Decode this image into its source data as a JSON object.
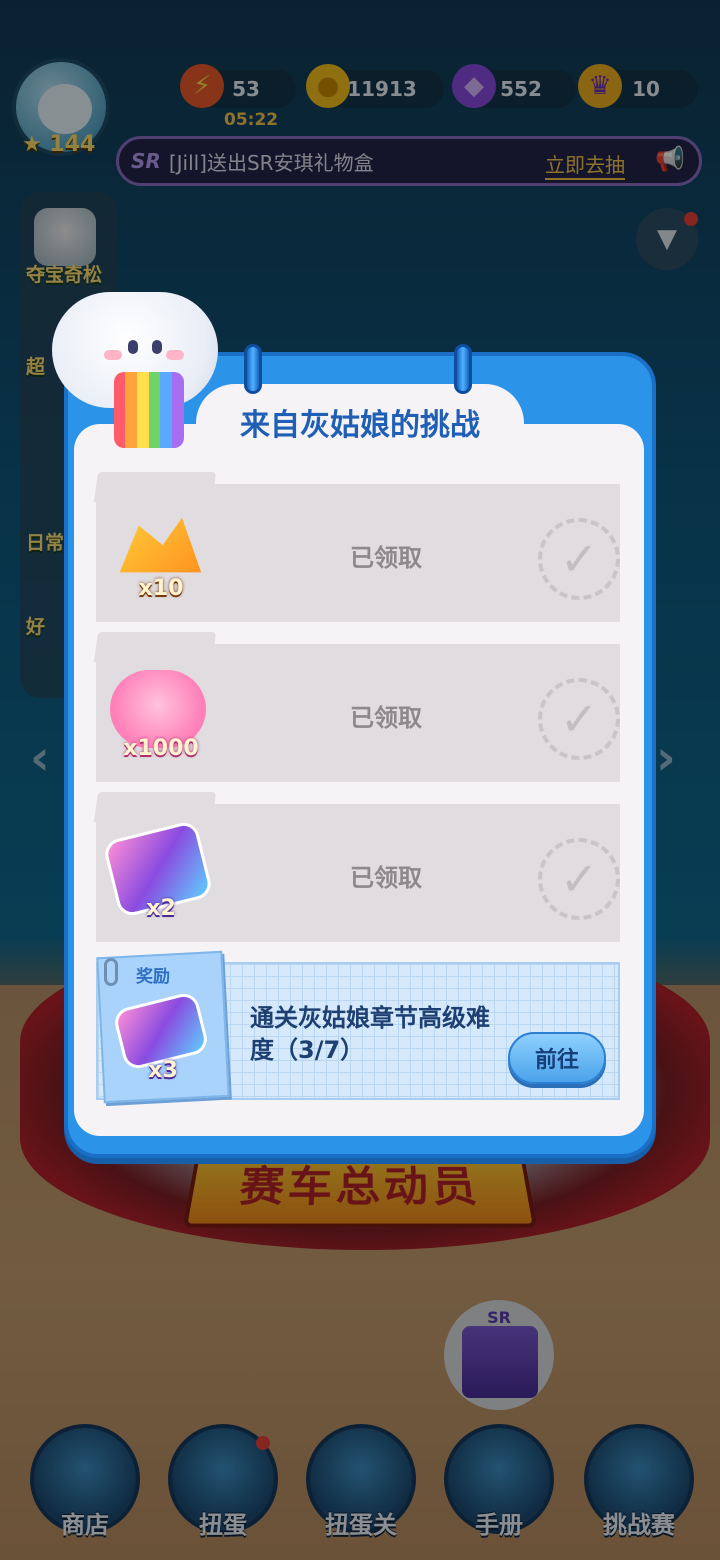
{
  "hud": {
    "level": "144",
    "energy": "53",
    "energy_timer": "05:22",
    "coins": "11913",
    "gems": "552",
    "crowns": "10"
  },
  "news": {
    "badge": "SR",
    "text": "[Jill]送出SR安琪礼物盒",
    "action": "立即去抽"
  },
  "side_menu": {
    "items": [
      {
        "label": "夺宝奇松"
      },
      {
        "label": "超"
      },
      {
        "label": "日常"
      },
      {
        "label": "好"
      }
    ]
  },
  "modal": {
    "title": "来自灰姑娘的挑战",
    "rewards": [
      {
        "quantity": "x10",
        "status": "已领取",
        "icon": "gold-bars-icon"
      },
      {
        "quantity": "x1000",
        "status": "已领取",
        "icon": "pink-hearts-icon"
      },
      {
        "quantity": "x2",
        "status": "已领取",
        "icon": "star-cards-icon"
      }
    ],
    "task": {
      "note_label": "奖励",
      "quantity": "x3",
      "description": "通关灰姑娘章节高级难度（3/7）",
      "button": "前往"
    }
  },
  "background": {
    "banner_text": "赛车总动员"
  },
  "sr_bubble": {
    "label": "SR"
  },
  "bottom_nav": [
    {
      "label": "商店"
    },
    {
      "label": "扭蛋"
    },
    {
      "label": "扭蛋关"
    },
    {
      "label": "手册"
    },
    {
      "label": "挑战赛"
    }
  ],
  "colors": {
    "modal_border": "#2b93e8",
    "title": "#1f5fb6",
    "claimed_card": "#e0dcdf",
    "task_card": "#d6e9fb"
  }
}
